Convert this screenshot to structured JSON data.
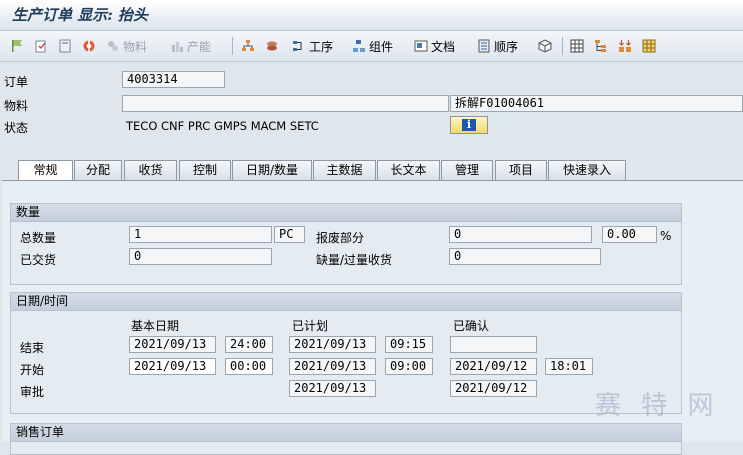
{
  "title": "生产订单 显示: 抬头",
  "toolbar": {
    "material": "物料",
    "capacity": "产能",
    "operations": "工序",
    "components": "组件",
    "documents": "文档",
    "sequences": "顺序"
  },
  "header": {
    "order_label": "订单",
    "order_value": "4003314",
    "material_label": "物料",
    "material_value": "",
    "material_desc": "拆解F01004061",
    "status_label": "状态",
    "status_value": "TECO CNF  PRC  GMPS MACM SETC"
  },
  "tabs": [
    "常规",
    "分配",
    "收货",
    "控制",
    "日期/数量",
    "主数据",
    "长文本",
    "管理",
    "项目",
    "快速录入"
  ],
  "qty": {
    "title": "数量",
    "total_label": "总数量",
    "total_value": "1",
    "unit": "PC",
    "scrap_label": "报废部分",
    "scrap_value": "0",
    "scrap_pct": "0.00",
    "pct_sign": "%",
    "delivered_label": "已交货",
    "delivered_value": "0",
    "short_label": "缺量/过量收货",
    "short_value": "0"
  },
  "dates": {
    "title": "日期/时间",
    "col_basic": "基本日期",
    "col_scheduled": "已计划",
    "col_confirmed": "已确认",
    "end_label": "结束",
    "start_label": "开始",
    "release_label": "审批",
    "end_basic_date": "2021/09/13",
    "end_basic_time": "24:00",
    "end_sched_date": "2021/09/13",
    "end_sched_time": "09:15",
    "end_conf_date": "",
    "start_basic_date": "2021/09/13",
    "start_basic_time": "00:00",
    "start_sched_date": "2021/09/13",
    "start_sched_time": "09:00",
    "start_conf_date": "2021/09/12",
    "start_conf_time": "18:01",
    "release_sched_date": "2021/09/13",
    "release_conf_date": "2021/09/12"
  },
  "sales": {
    "title": "销售订单"
  },
  "watermark": "赛 特 网"
}
